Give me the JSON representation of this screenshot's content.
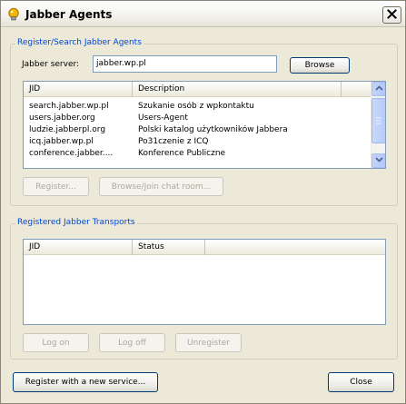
{
  "window": {
    "title": "Jabber Agents",
    "icons": {
      "app": "jabber-lightbulb-icon",
      "close": "close-icon"
    }
  },
  "search_group": {
    "legend": "Register/Search Jabber Agents",
    "server_label": "Jabber server:",
    "server_value": "jabber.wp.pl",
    "browse_label": "Browse",
    "columns": [
      "JID",
      "Description"
    ],
    "rows": [
      {
        "jid": "search.jabber.wp.pl",
        "description": "Szukanie osób z wpkontaktu"
      },
      {
        "jid": "users.jabber.org",
        "description": "Users-Agent"
      },
      {
        "jid": "ludzie.jabberpl.org",
        "description": "Polski katalog użytkowników Jabbera"
      },
      {
        "jid": "icq.jabber.wp.pl",
        "description": "Po31czenie z ICQ"
      },
      {
        "jid": "conference.jabber....",
        "description": "Konference Publiczne"
      }
    ],
    "register_label": "Register...",
    "browse_join_label": "Browse/Join chat room..."
  },
  "transports_group": {
    "legend": "Registered Jabber Transports",
    "columns": [
      "JID",
      "Status"
    ],
    "log_on_label": "Log on",
    "log_off_label": "Log off",
    "unregister_label": "Unregister"
  },
  "footer": {
    "register_new_label": "Register with a new service...",
    "close_label": "Close"
  },
  "colors": {
    "legend_blue": "#0046d5",
    "window_bg": "#ece9d8",
    "field_border": "#7f9db9"
  }
}
